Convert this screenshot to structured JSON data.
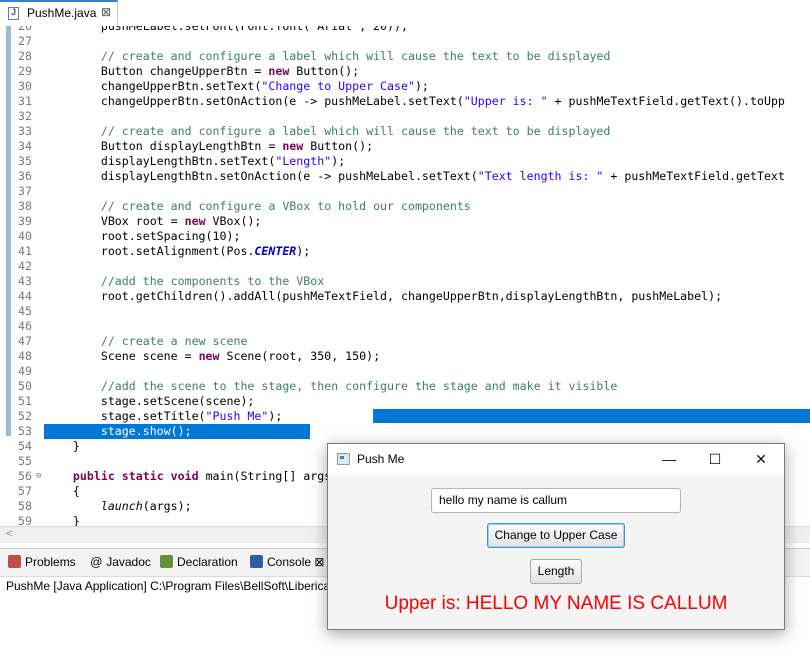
{
  "editor_tab": {
    "label": "PushMe.java",
    "close": "⊠"
  },
  "code_lines": [
    {
      "num": "26",
      "html": "        pushMeLabel.setFont(Font.font(\"Arial\", 20));"
    },
    {
      "num": "27",
      "html": ""
    },
    {
      "num": "28",
      "html": "        <span class=\"cm\">// create and configure a label which will cause the text to be displayed</span>"
    },
    {
      "num": "29",
      "html": "        Button changeUpperBtn = <span class=\"kw\">new</span> Button();"
    },
    {
      "num": "30",
      "html": "        changeUpperBtn.setText(<span class=\"str\">\"Change to Upper Case\"</span>);"
    },
    {
      "num": "31",
      "html": "        changeUpperBtn.setOnAction(e -&gt; pushMeLabel.setText(<span class=\"str\">\"Upper is: \"</span> + pushMeTextField.getText().toUpp"
    },
    {
      "num": "32",
      "html": ""
    },
    {
      "num": "33",
      "html": "        <span class=\"cm\">// create and configure a label which will cause the text to be displayed</span>"
    },
    {
      "num": "34",
      "html": "        Button displayLengthBtn = <span class=\"kw\">new</span> Button();"
    },
    {
      "num": "35",
      "html": "        displayLengthBtn.setText(<span class=\"str\">\"Length\"</span>);"
    },
    {
      "num": "36",
      "html": "        displayLengthBtn.setOnAction(e -&gt; pushMeLabel.setText(<span class=\"str\">\"Text length is: \"</span> + pushMeTextField.getText"
    },
    {
      "num": "37",
      "html": ""
    },
    {
      "num": "38",
      "html": "        <span class=\"cm\">// create and configure a VBox to hold our components</span>"
    },
    {
      "num": "39",
      "html": "        VBox root = <span class=\"kw\">new</span> VBox();"
    },
    {
      "num": "40",
      "html": "        root.setSpacing(10);"
    },
    {
      "num": "41",
      "html": "        root.setAlignment(Pos.<span class=\"cst\">CENTER</span>);"
    },
    {
      "num": "42",
      "html": ""
    },
    {
      "num": "43",
      "html": "        <span class=\"cm\">//add the components to the VBox</span>"
    },
    {
      "num": "44",
      "html": "        root.getChildren().addAll(pushMeTextField, changeUpperBtn,displayLengthBtn, pushMeLabel);"
    },
    {
      "num": "45",
      "html": ""
    },
    {
      "num": "46",
      "html": ""
    },
    {
      "num": "47",
      "html": "        <span class=\"cm\">// create a new scene</span>"
    },
    {
      "num": "48",
      "html": "        Scene scene = <span class=\"kw\">new</span> Scene(root, 350, 150);"
    },
    {
      "num": "49",
      "html": ""
    },
    {
      "num": "50",
      "html": "        <span class=\"cm\">//add the scene to the stage, then configure the stage and make it visible</span>"
    },
    {
      "num": "51",
      "html": "        stage.setScene(scene);"
    },
    {
      "num": "52",
      "html": "        stage.setTitle(<span class=\"str\">\"Push Me\"</span>);"
    },
    {
      "num": "53",
      "html": "        stage.show();"
    },
    {
      "num": "54",
      "html": "    }"
    },
    {
      "num": "55",
      "html": ""
    },
    {
      "num": "56",
      "html": "    <span class=\"kw\">public</span> <span class=\"kw\">static</span> <span class=\"kw\">void</span> main(String[] args)"
    },
    {
      "num": "57",
      "html": "    {"
    },
    {
      "num": "58",
      "html": "        <i>launch</i>(args);"
    },
    {
      "num": "59",
      "html": "    }"
    }
  ],
  "fold_marker": "⊖",
  "bottom_tabs": [
    {
      "label": "Problems",
      "icon": "problems-icon",
      "color": "#c0504d"
    },
    {
      "label": "Javadoc",
      "icon": "javadoc-icon",
      "color": "#444444"
    },
    {
      "label": "Declaration",
      "icon": "declaration-icon",
      "color": "#6a8f3c"
    },
    {
      "label": "Console",
      "icon": "console-icon",
      "color": "#2f5d9e"
    }
  ],
  "console_close": "⊠",
  "console_description": "PushMe [Java Application] C:\\Program Files\\BellSoft\\Liberica",
  "fx_window": {
    "title": "Push Me",
    "minimize": "—",
    "maximize": "☐",
    "close": "✕",
    "text_field_value": "hello my name is callum",
    "upper_button": "Change to Upper Case",
    "length_button": "Length",
    "result_label": "Upper is: HELLO MY NAME IS CALLUM"
  },
  "colors": {
    "selection": "#0078d7",
    "result_text": "#ff0000",
    "keyword": "#7f0055",
    "string": "#2a00ff",
    "comment": "#3f7f5f"
  }
}
